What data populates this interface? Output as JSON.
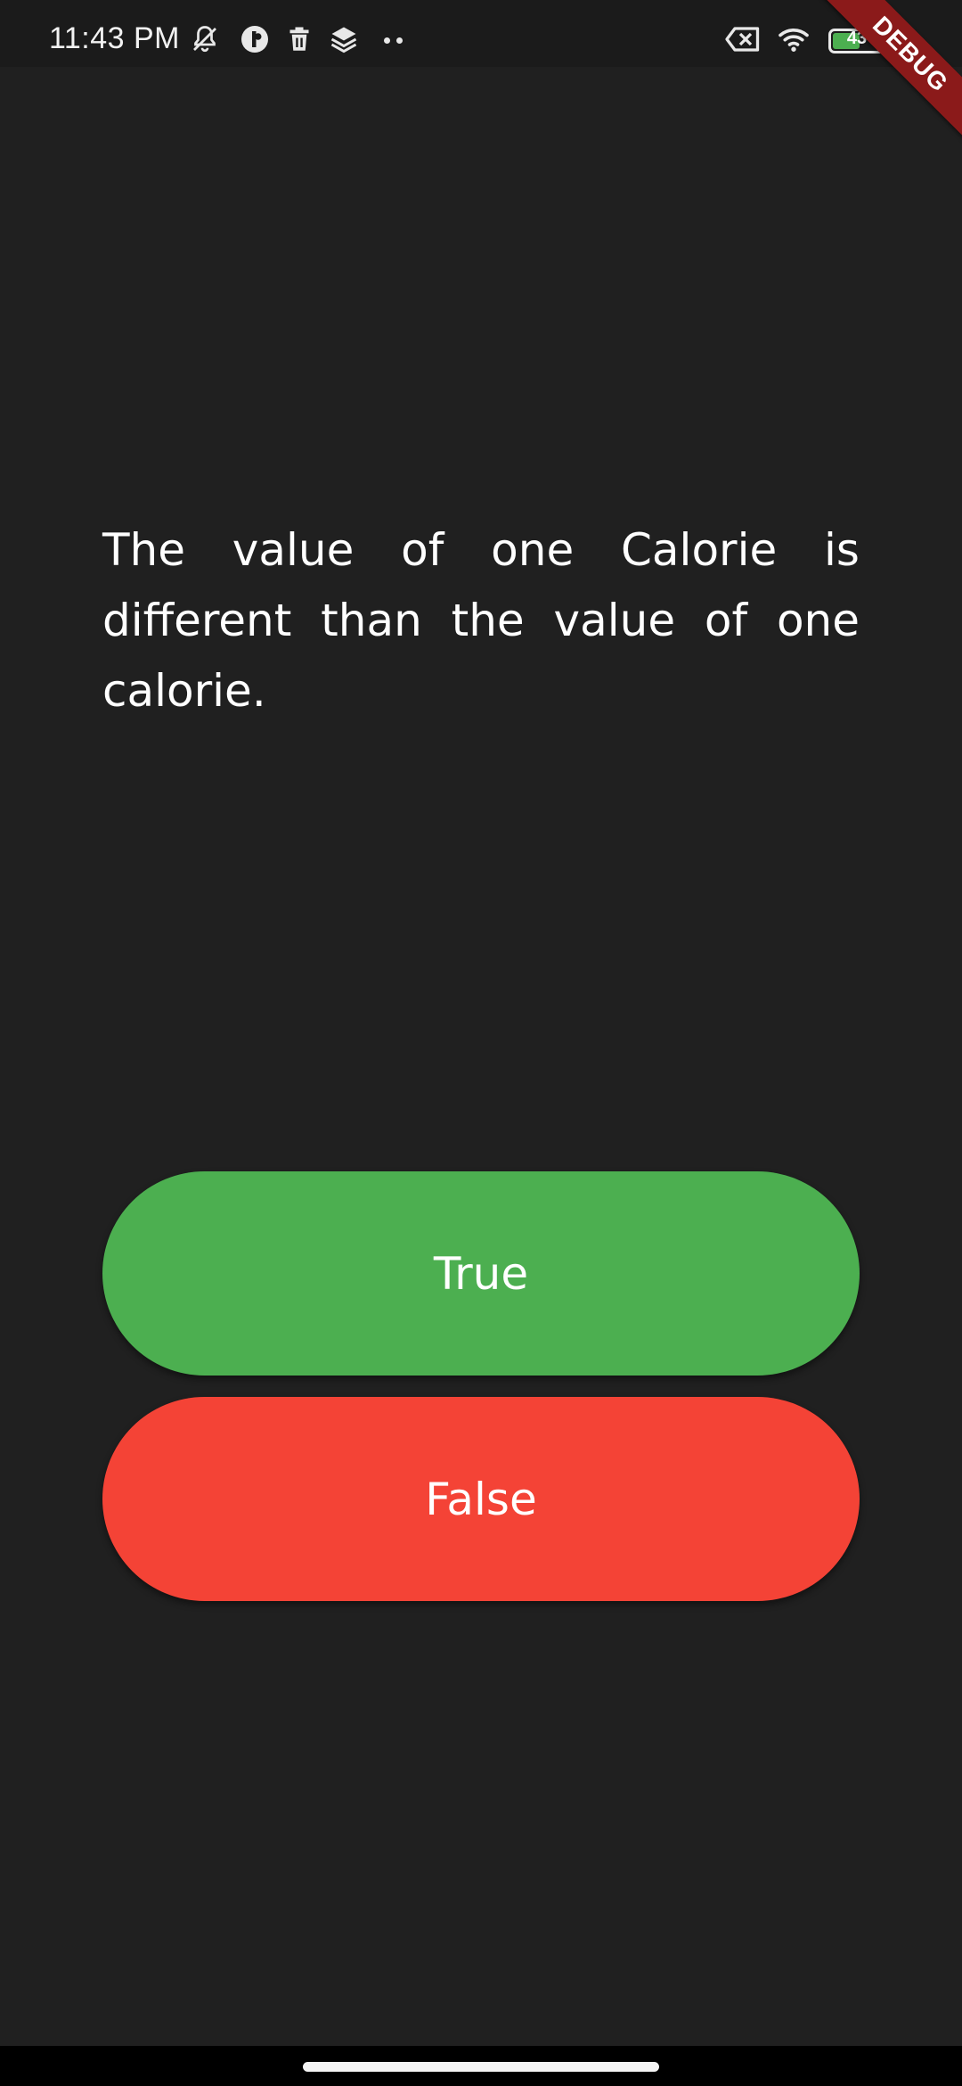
{
  "status_bar": {
    "time": "11:43 PM",
    "left_icons": [
      "muted-bell-icon",
      "app-badge-icon",
      "trash-icon",
      "layers-icon",
      "more-dots-icon"
    ],
    "right_icons": [
      "no-sim-icon",
      "wifi-icon",
      "battery-icon"
    ],
    "battery_level": "43",
    "battery_color": "#4caf50"
  },
  "debug_banner": {
    "label": "DEBUG"
  },
  "quiz": {
    "question": "The value of one Calorie is different than the value of one calorie.",
    "true_label": "True",
    "false_label": "False",
    "true_color": "#4caf50",
    "false_color": "#f44336"
  },
  "colors": {
    "background": "#202020",
    "text": "#ffffff"
  }
}
